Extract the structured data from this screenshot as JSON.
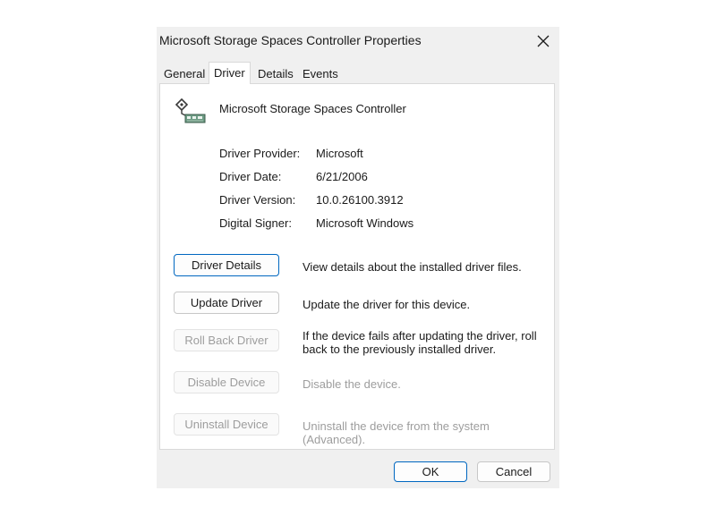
{
  "dialog": {
    "title": "Microsoft Storage Spaces Controller Properties",
    "close_icon": "close-icon"
  },
  "tabs": [
    {
      "label": "General"
    },
    {
      "label": "Driver",
      "active": true
    },
    {
      "label": "Details"
    },
    {
      "label": "Events"
    }
  ],
  "device": {
    "icon": "storage-controller-icon",
    "name": "Microsoft Storage Spaces Controller"
  },
  "driver_info": [
    {
      "label": "Driver Provider:",
      "value": "Microsoft"
    },
    {
      "label": "Driver Date:",
      "value": "6/21/2006"
    },
    {
      "label": "Driver Version:",
      "value": "10.0.26100.3912"
    },
    {
      "label": "Digital Signer:",
      "value": "Microsoft Windows"
    }
  ],
  "actions": [
    {
      "label": "Driver Details",
      "description": "View details about the installed driver files.",
      "enabled": true
    },
    {
      "label": "Update Driver",
      "description": "Update the driver for this device.",
      "enabled": true
    },
    {
      "label": "Roll Back Driver",
      "description": "If the device fails after updating the driver, roll back to the previously installed driver.",
      "enabled": false
    },
    {
      "label": "Disable Device",
      "description": "Disable the device.",
      "enabled": false
    },
    {
      "label": "Uninstall Device",
      "description": "Uninstall the device from the system (Advanced).",
      "enabled": false
    }
  ],
  "footer": {
    "ok_label": "OK",
    "cancel_label": "Cancel"
  },
  "colors": {
    "dialog_bg": "#f0f0f0",
    "panel_bg": "#ffffff",
    "focus_border": "#0067c0",
    "disabled_text": "#9d9d9d"
  }
}
